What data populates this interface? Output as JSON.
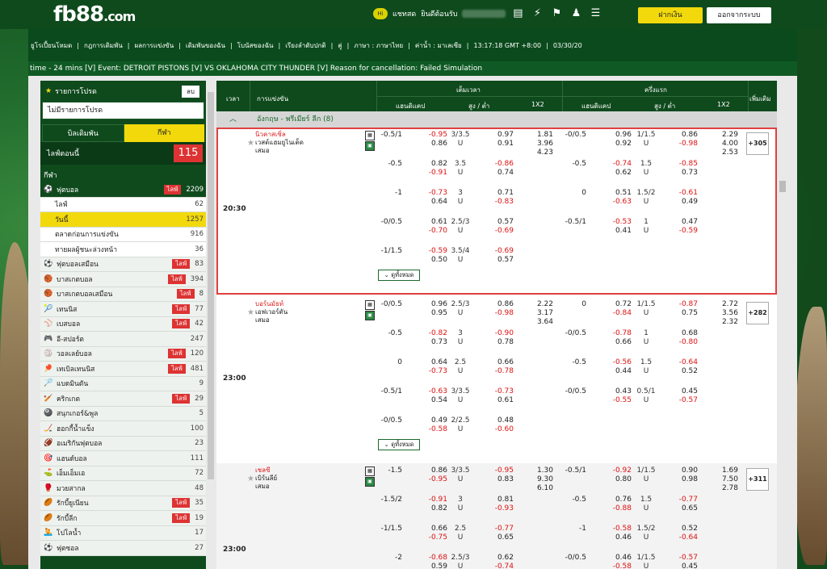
{
  "brand": {
    "logo": "fb88",
    "logo_suffix": ".com"
  },
  "topbar": {
    "chat": "แชทสด",
    "welcome": "ยินดีต้อนรับ",
    "deposit": "ฝากเงิน",
    "logout": "ออกจากระบบ"
  },
  "nav": {
    "items": [
      "ยูโรเปี้ยนโหมด",
      "กฎการเดิมพัน",
      "ผลการแข่งขัน",
      "เดิมพันของฉัน",
      "โบนัสของฉัน",
      "เรียงลำดับปกติ",
      "คู่",
      "ภาษา : ภาษาไทย",
      "ค่าน้ำ : มาเลเซีย",
      "13:17:18 GMT +8:00",
      "03/30/20"
    ]
  },
  "ticker": "time - 24 mins [V]     Event: DETROIT PISTONS [V] VS OKLAHOMA CITY THUNDER [V] Reason for cancellation: Failed Simulation",
  "sidebar": {
    "fav_title": "รายการโปรด",
    "fav_del": "ลบ",
    "fav_none": "ไม่มีรายการโปรด",
    "tab_bet": "บิลเดิมพัน",
    "tab_sport": "กีฬา",
    "live_now": "ไลฟ์ตอนนี้",
    "live_count": "115",
    "sport_label": "กีฬา",
    "football": {
      "name": "ฟุตบอล",
      "live": "ไลฟ์",
      "count": "2209"
    },
    "sub": [
      {
        "name": "ไลฟ์",
        "count": "62"
      },
      {
        "name": "วันนี้",
        "count": "1257"
      },
      {
        "name": "ตลาดก่อนการแข่งขัน",
        "count": "916"
      },
      {
        "name": "ทายผลผู้ชนะล่วงหน้า",
        "count": "36"
      }
    ],
    "sports": [
      {
        "icon": "⚽",
        "name": "ฟุตบอลเสมือน",
        "live": "ไลฟ์",
        "count": "83"
      },
      {
        "icon": "🏀",
        "name": "บาสเกตบอล",
        "live": "ไลฟ์",
        "count": "394"
      },
      {
        "icon": "🏀",
        "name": "บาสเกตบอลเสมือน",
        "live": "ไลฟ์",
        "count": "8"
      },
      {
        "icon": "🎾",
        "name": "เทนนิส",
        "live": "ไลฟ์",
        "count": "77"
      },
      {
        "icon": "⚾",
        "name": "เบสบอล",
        "live": "ไลฟ์",
        "count": "42"
      },
      {
        "icon": "🎮",
        "name": "อี-สปอร์ต",
        "live": "",
        "count": "247"
      },
      {
        "icon": "🏐",
        "name": "วอลเลย์บอล",
        "live": "ไลฟ์",
        "count": "120"
      },
      {
        "icon": "🏓",
        "name": "เทเบิลเทนนิส",
        "live": "ไลฟ์",
        "count": "481"
      },
      {
        "icon": "🏸",
        "name": "แบดมินตัน",
        "live": "",
        "count": "9"
      },
      {
        "icon": "🏏",
        "name": "คริกเกต",
        "live": "ไลฟ์",
        "count": "29"
      },
      {
        "icon": "🎱",
        "name": "สนุกเกอร์&พูล",
        "live": "",
        "count": "5"
      },
      {
        "icon": "🏒",
        "name": "ฮอกกี้น้ำแข็ง",
        "live": "",
        "count": "100"
      },
      {
        "icon": "🏈",
        "name": "อเมริกันฟุตบอล",
        "live": "",
        "count": "23"
      },
      {
        "icon": "🎯",
        "name": "แฮนด์บอล",
        "live": "",
        "count": "111"
      },
      {
        "icon": "⛳",
        "name": "เอ็มเอ็มเอ",
        "live": "",
        "count": "72"
      },
      {
        "icon": "🥊",
        "name": "มวยสากล",
        "live": "",
        "count": "48"
      },
      {
        "icon": "🏉",
        "name": "รักบี้ยูเนียน",
        "live": "ไลฟ์",
        "count": "35"
      },
      {
        "icon": "🏉",
        "name": "รักบี้ลีก",
        "live": "ไลฟ์",
        "count": "19"
      },
      {
        "icon": "🤽",
        "name": "โปโลน้ำ",
        "live": "",
        "count": "17"
      },
      {
        "icon": "⚽",
        "name": "ฟุตซอล",
        "live": "",
        "count": "27"
      }
    ]
  },
  "grid": {
    "h_time": "เวลา",
    "h_event": "การแข่งขัน",
    "h_full": "เต็มเวลา",
    "h_half": "ครึ่งแรก",
    "h_more": "เพิ่มเติม",
    "hdp": "แฮนดิแคป",
    "ou": "สูง / ต่ำ",
    "x12": "1X2",
    "hdp2": "แฮนดิแคป",
    "ou2": "สูง / ต่ำ",
    "x122": "1X2"
  },
  "league": "อังกฤษ - พรีเมียร์ ลีก (8)",
  "matches": [
    {
      "time": "20:30",
      "home": "นิวคาสเซิ่ล",
      "away": "เวสต์แฮมยูไนเต็ด",
      "draw": "เสมอ",
      "more": "+305",
      "expand": "ดูทั้งหมด",
      "rows": [
        [
          "-0.5/1",
          "-0.95",
          "0.86",
          "3/3.5",
          "U",
          "0.97",
          "0.91",
          "1.81",
          "3.96",
          "4.23",
          "-0/0.5",
          "0.96",
          "0.92",
          "1/1.5",
          "U",
          "0.86",
          "-0.98",
          "2.29",
          "4.00",
          "2.53"
        ],
        [
          "-0.5",
          "0.82",
          "-0.91",
          "3.5",
          "U",
          "-0.86",
          "0.74",
          "",
          "",
          "",
          "-0.5",
          "-0.74",
          "0.62",
          "1.5",
          "U",
          "-0.85",
          "0.73",
          "",
          "",
          ""
        ],
        [
          "-1",
          "-0.73",
          "0.64",
          "3",
          "U",
          "0.71",
          "-0.83",
          "",
          "",
          "",
          "0",
          "0.51",
          "-0.63",
          "1.5/2",
          "U",
          "-0.61",
          "0.49",
          "",
          "",
          ""
        ],
        [
          "-0/0.5",
          "0.61",
          "-0.70",
          "2.5/3",
          "U",
          "0.57",
          "-0.69",
          "",
          "",
          "",
          "-0.5/1",
          "-0.53",
          "0.41",
          "1",
          "U",
          "0.47",
          "-0.59",
          "",
          "",
          ""
        ],
        [
          "-1/1.5",
          "-0.59",
          "0.50",
          "3.5/4",
          "U",
          "-0.69",
          "0.57",
          "",
          "",
          "",
          "",
          "",
          "",
          "",
          "",
          "",
          "",
          "",
          "",
          ""
        ]
      ]
    },
    {
      "time": "23:00",
      "home": "บอร์นมัธท์",
      "away": "เอฟเวอร์ตัน",
      "draw": "เสมอ",
      "more": "+282",
      "expand": "ดูทั้งหมด",
      "rows": [
        [
          "-0/0.5",
          "0.96",
          "0.95",
          "2.5/3",
          "U",
          "0.86",
          "-0.98",
          "2.22",
          "3.17",
          "3.64",
          "0",
          "0.72",
          "-0.84",
          "1/1.5",
          "U",
          "-0.87",
          "0.75",
          "2.72",
          "3.56",
          "2.32"
        ],
        [
          "-0.5",
          "-0.82",
          "0.73",
          "3",
          "U",
          "-0.90",
          "0.78",
          "",
          "",
          "",
          "-0/0.5",
          "-0.78",
          "0.66",
          "1",
          "U",
          "0.68",
          "-0.80",
          "",
          "",
          ""
        ],
        [
          "0",
          "0.64",
          "-0.73",
          "2.5",
          "U",
          "0.66",
          "-0.78",
          "",
          "",
          "",
          "-0.5",
          "-0.56",
          "0.44",
          "1.5",
          "U",
          "-0.64",
          "0.52",
          "",
          "",
          ""
        ],
        [
          "-0.5/1",
          "-0.63",
          "0.54",
          "3/3.5",
          "U",
          "-0.73",
          "0.61",
          "",
          "",
          "",
          "-0/0.5",
          "0.43",
          "-0.55",
          "0.5/1",
          "U",
          "0.45",
          "-0.57",
          "",
          "",
          ""
        ],
        [
          "-0/0.5",
          "0.49",
          "-0.58",
          "2/2.5",
          "U",
          "0.48",
          "-0.60",
          "",
          "",
          "",
          "",
          "",
          "",
          "",
          "",
          "",
          "",
          "",
          "",
          ""
        ]
      ]
    },
    {
      "time": "23:00",
      "home": "เชลซี",
      "away": "เบิร์นลีย์",
      "draw": "เสมอ",
      "more": "+311",
      "expand": "",
      "rows": [
        [
          "-1.5",
          "0.86",
          "-0.95",
          "3/3.5",
          "U",
          "-0.95",
          "0.83",
          "1.30",
          "9.30",
          "6.10",
          "-0.5/1",
          "-0.92",
          "0.80",
          "1/1.5",
          "U",
          "0.90",
          "0.98",
          "1.69",
          "7.50",
          "2.78"
        ],
        [
          "-1.5/2",
          "-0.91",
          "0.82",
          "3",
          "U",
          "0.81",
          "-0.93",
          "",
          "",
          "",
          "-0.5",
          "0.76",
          "-0.88",
          "1.5",
          "U",
          "-0.77",
          "0.65",
          "",
          "",
          ""
        ],
        [
          "-1/1.5",
          "0.66",
          "-0.75",
          "2.5",
          "U",
          "-0.77",
          "0.65",
          "",
          "",
          "",
          "-1",
          "-0.58",
          "0.46",
          "1.5/2",
          "U",
          "0.52",
          "-0.64",
          "",
          "",
          ""
        ],
        [
          "-2",
          "-0.68",
          "0.59",
          "2.5/3",
          "U",
          "0.62",
          "-0.74",
          "",
          "",
          "",
          "-0/0.5",
          "0.46",
          "-0.58",
          "1/1.5",
          "U",
          "-0.57",
          "0.45",
          "",
          "",
          ""
        ]
      ]
    }
  ]
}
